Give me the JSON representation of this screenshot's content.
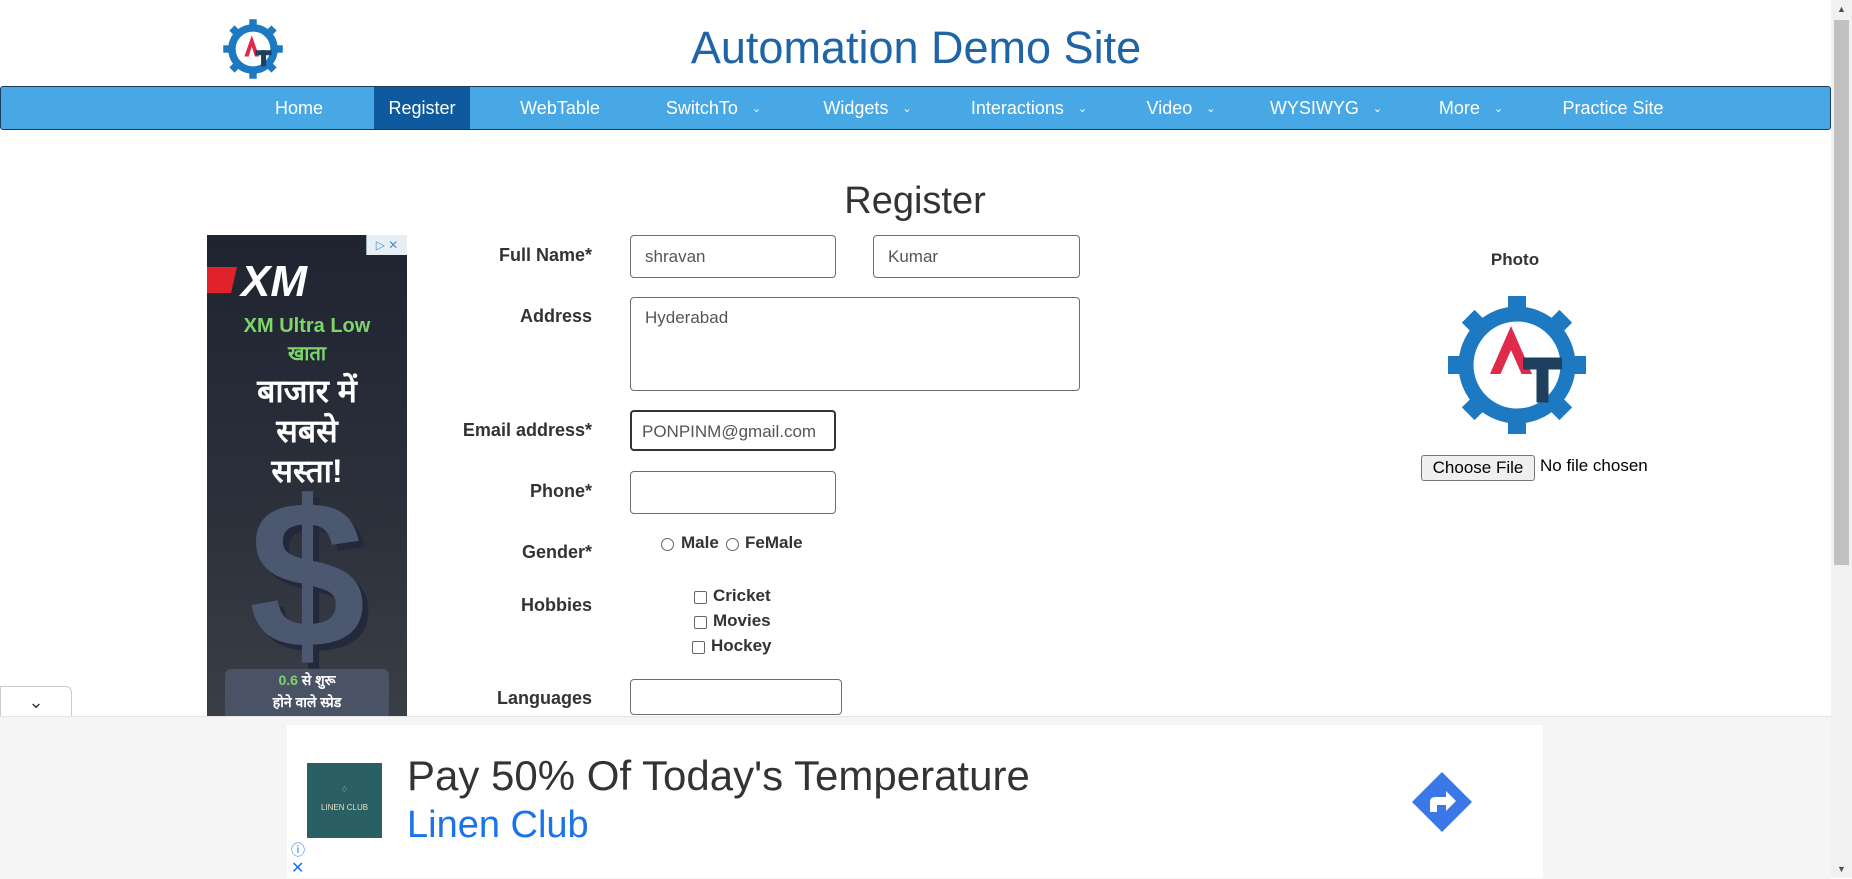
{
  "header": {
    "site_title": "Automation Demo Site",
    "logo_icon": "automation-gear-logo"
  },
  "nav": {
    "items": [
      {
        "label": "Home",
        "active": false,
        "dropdown": false
      },
      {
        "label": "Register",
        "active": true,
        "dropdown": false
      },
      {
        "label": "WebTable",
        "active": false,
        "dropdown": false
      },
      {
        "label": "SwitchTo",
        "active": false,
        "dropdown": true
      },
      {
        "label": "Widgets",
        "active": false,
        "dropdown": true
      },
      {
        "label": "Interactions",
        "active": false,
        "dropdown": true
      },
      {
        "label": "Video",
        "active": false,
        "dropdown": true
      },
      {
        "label": "WYSIWYG",
        "active": false,
        "dropdown": true
      },
      {
        "label": "More",
        "active": false,
        "dropdown": true
      },
      {
        "label": "Practice Site",
        "active": false,
        "dropdown": false
      }
    ]
  },
  "page": {
    "heading": "Register"
  },
  "form": {
    "full_name_label": "Full Name*",
    "first_name_value": "shravan",
    "last_name_value": "Kumar",
    "address_label": "Address",
    "address_value": "Hyderabad",
    "email_label": "Email address*",
    "email_value": "PONPINM@gmail.com",
    "phone_label": "Phone*",
    "phone_value": "",
    "gender_label": "Gender*",
    "gender_options": [
      "Male",
      "FeMale"
    ],
    "hobbies_label": "Hobbies",
    "hobbies_options": [
      "Cricket",
      "Movies",
      "Hockey"
    ],
    "languages_label": "Languages",
    "languages_value": ""
  },
  "photo": {
    "label": "Photo",
    "choose_file_label": "Choose File",
    "file_status": "No file chosen"
  },
  "side_ad": {
    "brand": "XM",
    "line1": "XM Ultra Low",
    "line2": "खाता",
    "line3": "बाजार में",
    "line4": "सबसे",
    "line5": "सस्ता!",
    "promo_value": "0.6",
    "promo_text1": " से शुरू",
    "promo_text2": "होने वाले स्प्रेड"
  },
  "bottom_ad": {
    "headline": "Pay 50% Of Today's Temperature",
    "brand": "Linen Club",
    "logo_text": "LINEN CLUB"
  },
  "colors": {
    "nav_bg": "#48a8e6",
    "nav_active": "#0f5a9e",
    "title": "#1f64a6",
    "ad_link": "#1a73e8"
  }
}
